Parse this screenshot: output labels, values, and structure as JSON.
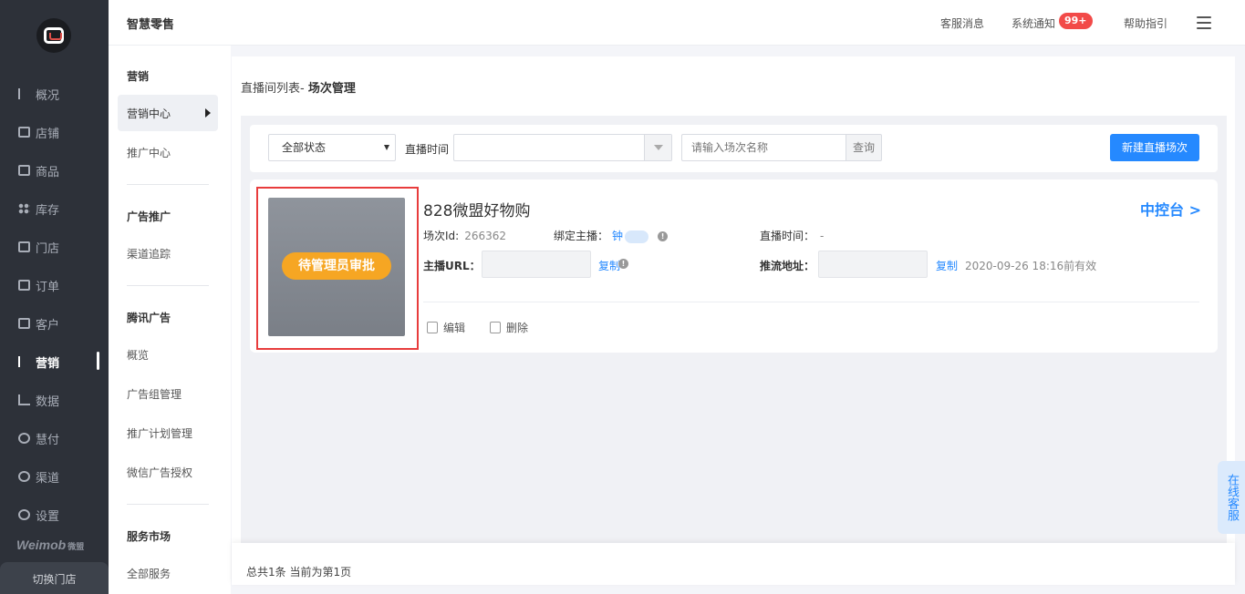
{
  "rail": {
    "items": [
      {
        "label": "概况",
        "icon": "overview-icon"
      },
      {
        "label": "店铺",
        "icon": "shop-icon"
      },
      {
        "label": "商品",
        "icon": "goods-icon"
      },
      {
        "label": "库存",
        "icon": "stock-icon"
      },
      {
        "label": "门店",
        "icon": "store-icon"
      },
      {
        "label": "订单",
        "icon": "order-icon"
      },
      {
        "label": "客户",
        "icon": "customer-icon"
      },
      {
        "label": "营销",
        "icon": "marketing-icon"
      },
      {
        "label": "数据",
        "icon": "data-icon"
      },
      {
        "label": "慧付",
        "icon": "pay-icon"
      },
      {
        "label": "渠道",
        "icon": "channel-icon"
      },
      {
        "label": "设置",
        "icon": "settings-icon"
      }
    ],
    "active": "营销",
    "brand": "Weimob",
    "brand_cn": "微盟",
    "switch_store": "切换门店"
  },
  "header": {
    "app_title": "智慧零售",
    "service_messages": "客服消息",
    "system_notice": "系统通知",
    "notice_badge": "99+",
    "help": "帮助指引"
  },
  "subnav": {
    "sections": [
      {
        "title": "营销",
        "items": [
          "营销中心",
          "推广中心"
        ]
      },
      {
        "title": "广告推广",
        "items": [
          "渠道追踪"
        ]
      },
      {
        "title": "腾讯广告",
        "items": [
          "概览",
          "广告组管理",
          "推广计划管理",
          "微信广告授权"
        ]
      },
      {
        "title": "服务市场",
        "items": [
          "全部服务"
        ]
      }
    ],
    "active": "营销中心"
  },
  "breadcrumb": {
    "parent": "直播间列表-",
    "current": "场次管理"
  },
  "filter": {
    "status_select": "全部状态",
    "time_label": "直播时间",
    "search_placeholder": "请输入场次名称",
    "search_button": "查询",
    "new_button": "新建直播场次"
  },
  "live": {
    "status_tag": "待管理员审批",
    "title": "828微盟好物购",
    "console": "中控台 >",
    "session_id_label": "场次Id:",
    "session_id": "266362",
    "anchor_label": "绑定主播：",
    "anchor_name": "钟",
    "live_time_label": "直播时间：",
    "live_time": "-",
    "anchor_url_label": "主播URL：",
    "copy": "复制",
    "push_url_label": "推流地址：",
    "valid_until": "2020-09-26 18:16前有效",
    "edit": "编辑",
    "delete": "删除"
  },
  "pager": {
    "summary": "总共1条 当前为第1页"
  },
  "online_service": "在线客服",
  "colors": {
    "accent": "#2589ff",
    "pending": "#f6a623",
    "rail": "#2d3139",
    "highlight": "#e83c3c"
  }
}
